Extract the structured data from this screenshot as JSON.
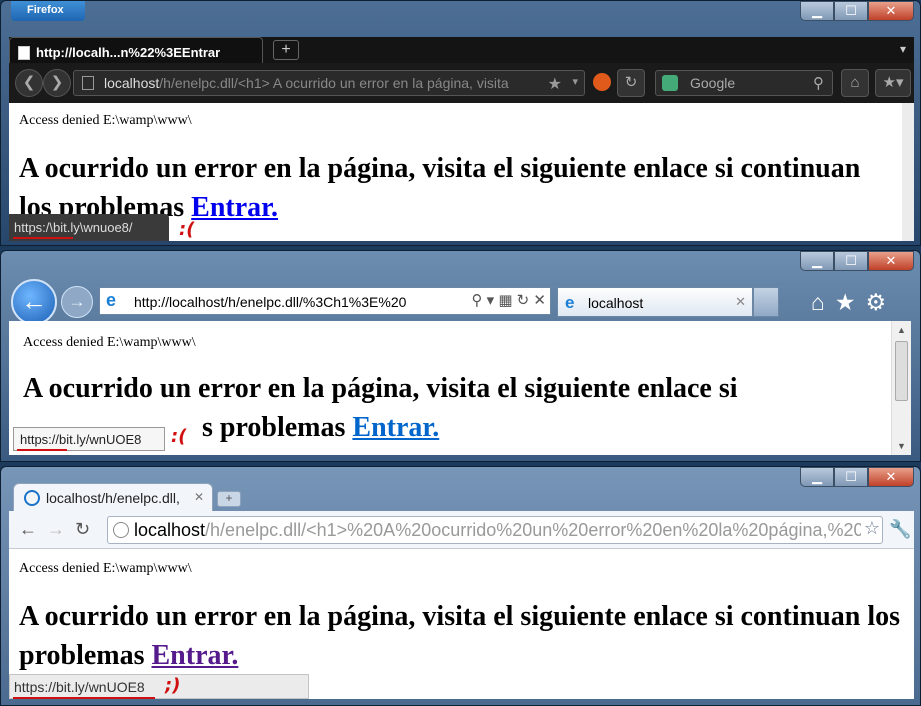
{
  "firefox": {
    "menu_button": "Firefox",
    "tab_title": "http://localh...n%22%3EEntrar",
    "url_host": "localhost",
    "url_rest": "/h/enelpc.dll/<h1> A ocurrido un error en la página, visita",
    "search_placeholder": "Google",
    "access_text": "Access denied E:\\wamp\\www\\",
    "heading_text": "A ocurrido un error en la página, visita el siguiente enlace si continuan los problemas",
    "link_text": "Entrar.",
    "status_url": "https:/\\bit.ly\\wnuoe8/",
    "annotation": ":(",
    "link_color": "#0000ee"
  },
  "ie": {
    "url": "http://localhost/h/enelpc.dll/%3Ch1%3E%20",
    "tab_title": "localhost",
    "access_text": "Access denied E:\\wamp\\www\\",
    "heading_line1": "A ocurrido un error en la página, visita el siguiente enlace si",
    "heading_line2_visible": "s problemas",
    "link_text": "Entrar.",
    "status_url": "https://bit.ly/wnUOE8",
    "annotation": ":(",
    "link_color": "#0066cc"
  },
  "chrome": {
    "tab_title": "localhost/h/enelpc.dll,",
    "url_host": "localhost",
    "url_rest": "/h/enelpc.dll/<h1>%20A%20ocurrido%20un%20error%20en%20la%20página,%20",
    "access_text": "Access denied E:\\wamp\\www\\",
    "heading_text": "A ocurrido un error en la página, visita el siguiente enlace si continuan los problemas",
    "link_text": "Entrar.",
    "status_url": "https://bit.ly/wnUOE8",
    "annotation": ";)",
    "link_color": "#551a8b"
  }
}
